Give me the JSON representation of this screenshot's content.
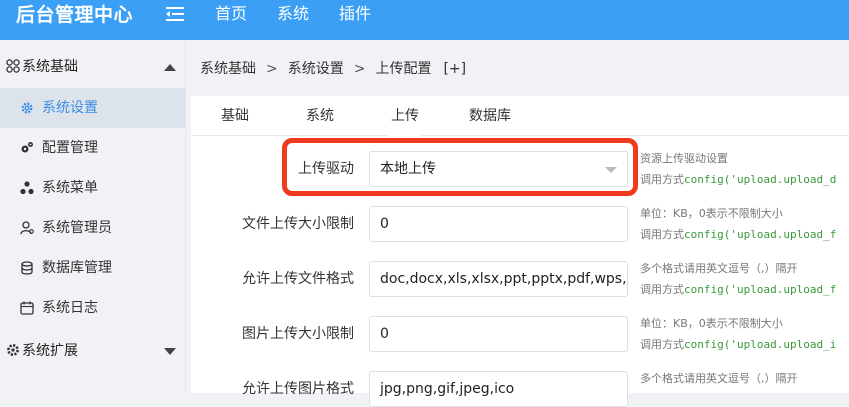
{
  "header": {
    "brand": "后台管理中心",
    "nav": [
      "首页",
      "系统",
      "插件"
    ]
  },
  "sidebar": {
    "group1": "系统基础",
    "items": [
      "系统设置",
      "配置管理",
      "系统菜单",
      "系统管理员",
      "数据库管理",
      "系统日志"
    ],
    "group2": "系统扩展"
  },
  "breadcrumb": [
    "系统基础",
    "系统设置",
    "上传配置",
    "[+]"
  ],
  "tabs": [
    "基础",
    "系统",
    "上传",
    "数据库"
  ],
  "form": {
    "rows": [
      {
        "label": "上传驱动",
        "value": "本地上传",
        "hint": "资源上传驱动设置",
        "call": "调用方式",
        "code": "config('upload.upload_d"
      },
      {
        "label": "文件上传大小限制",
        "value": "0",
        "hint": "单位：KB，0表示不限制大小",
        "call": "调用方式",
        "code": "config('upload.upload_f"
      },
      {
        "label": "允许上传文件格式",
        "value": "doc,docx,xls,xlsx,ppt,pptx,pdf,wps,txt,r",
        "hint": "多个格式请用英文逗号（,）隔开",
        "call": "调用方式",
        "code": "config('upload.upload_f"
      },
      {
        "label": "图片上传大小限制",
        "value": "0",
        "hint": "单位：KB，0表示不限制大小",
        "call": "调用方式",
        "code": "config('upload.upload_i"
      },
      {
        "label": "允许上传图片格式",
        "value": "jpg,png,gif,jpeg,ico",
        "hint": "多个格式请用英文逗号（,）隔开",
        "call": "",
        "code": ""
      }
    ]
  },
  "colors": {
    "accent": "#3a9ff5",
    "highlight": "#f03a1e",
    "code": "#3a9a3a"
  }
}
